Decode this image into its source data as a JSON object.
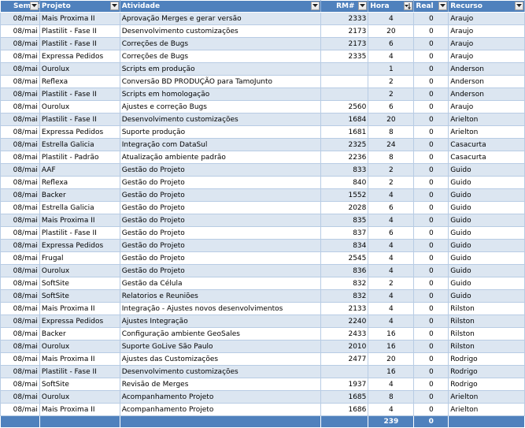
{
  "headers": {
    "semana": "Seman",
    "projeto": "Projeto",
    "atividade": "Atividade",
    "rm": "RM#",
    "hora": "Hora",
    "real": "Real",
    "recurso": "Recurso"
  },
  "rows": [
    {
      "semana": "08/mai",
      "projeto": "Mais Proxima II",
      "atividade": "Aprovação Merges e gerar versão",
      "rm": "2333",
      "hora": "4",
      "real": "0",
      "recurso": "Araujo"
    },
    {
      "semana": "08/mai",
      "projeto": "Plastilit - Fase II",
      "atividade": "Desenvolvimento customizações",
      "rm": "2173",
      "hora": "20",
      "real": "0",
      "recurso": "Araujo"
    },
    {
      "semana": "08/mai",
      "projeto": "Plastilit - Fase II",
      "atividade": "Correções de Bugs",
      "rm": "2173",
      "hora": "6",
      "real": "0",
      "recurso": "Araujo"
    },
    {
      "semana": "08/mai",
      "projeto": "Expressa Pedidos",
      "atividade": "Correções de Bugs",
      "rm": "2335",
      "hora": "4",
      "real": "0",
      "recurso": "Araujo"
    },
    {
      "semana": "08/mai",
      "projeto": "Ourolux",
      "atividade": "Scripts em produção",
      "rm": "",
      "hora": "1",
      "real": "0",
      "recurso": "Anderson"
    },
    {
      "semana": "08/mai",
      "projeto": "Reflexa",
      "atividade": "Conversão BD PRODUÇÃO para TamoJunto",
      "rm": "",
      "hora": "2",
      "real": "0",
      "recurso": "Anderson"
    },
    {
      "semana": "08/mai",
      "projeto": "Plastilit - Fase II",
      "atividade": "Scripts em homologação",
      "rm": "",
      "hora": "2",
      "real": "0",
      "recurso": "Anderson"
    },
    {
      "semana": "08/mai",
      "projeto": "Ourolux",
      "atividade": "Ajustes e correção Bugs",
      "rm": "2560",
      "hora": "6",
      "real": "0",
      "recurso": "Araujo"
    },
    {
      "semana": "08/mai",
      "projeto": "Plastilit - Fase II",
      "atividade": "Desenvolvimento customizações",
      "rm": "1684",
      "hora": "20",
      "real": "0",
      "recurso": "Arielton"
    },
    {
      "semana": "08/mai",
      "projeto": "Expressa Pedidos",
      "atividade": "Suporte produção",
      "rm": "1681",
      "hora": "8",
      "real": "0",
      "recurso": "Arielton"
    },
    {
      "semana": "08/mai",
      "projeto": "Estrella Galicia",
      "atividade": "Integração com DataSul",
      "rm": "2325",
      "hora": "24",
      "real": "0",
      "recurso": "Casacurta"
    },
    {
      "semana": "08/mai",
      "projeto": "Plastilit - Padrão",
      "atividade": "Atualização ambiente padrão",
      "rm": "2236",
      "hora": "8",
      "real": "0",
      "recurso": "Casacurta"
    },
    {
      "semana": "08/mai",
      "projeto": "AAF",
      "atividade": "Gestão do Projeto",
      "rm": "833",
      "hora": "2",
      "real": "0",
      "recurso": "Guido"
    },
    {
      "semana": "08/mai",
      "projeto": "Reflexa",
      "atividade": "Gestão do Projeto",
      "rm": "840",
      "hora": "2",
      "real": "0",
      "recurso": "Guido"
    },
    {
      "semana": "08/mai",
      "projeto": "Backer",
      "atividade": "Gestão do Projeto",
      "rm": "1552",
      "hora": "4",
      "real": "0",
      "recurso": "Guido"
    },
    {
      "semana": "08/mai",
      "projeto": "Estrella Galicia",
      "atividade": "Gestão do Projeto",
      "rm": "2028",
      "hora": "6",
      "real": "0",
      "recurso": "Guido"
    },
    {
      "semana": "08/mai",
      "projeto": "Mais Proxima II",
      "atividade": "Gestão do Projeto",
      "rm": "835",
      "hora": "4",
      "real": "0",
      "recurso": "Guido"
    },
    {
      "semana": "08/mai",
      "projeto": "Plastilit - Fase II",
      "atividade": "Gestão do Projeto",
      "rm": "837",
      "hora": "6",
      "real": "0",
      "recurso": "Guido"
    },
    {
      "semana": "08/mai",
      "projeto": "Expressa Pedidos",
      "atividade": "Gestão do Projeto",
      "rm": "834",
      "hora": "4",
      "real": "0",
      "recurso": "Guido"
    },
    {
      "semana": "08/mai",
      "projeto": "Frugal",
      "atividade": "Gestão do Projeto",
      "rm": "2545",
      "hora": "4",
      "real": "0",
      "recurso": "Guido"
    },
    {
      "semana": "08/mai",
      "projeto": "Ourolux",
      "atividade": "Gestão do Projeto",
      "rm": "836",
      "hora": "4",
      "real": "0",
      "recurso": "Guido"
    },
    {
      "semana": "08/mai",
      "projeto": "SoftSite",
      "atividade": "Gestão da Célula",
      "rm": "832",
      "hora": "2",
      "real": "0",
      "recurso": "Guido"
    },
    {
      "semana": "08/mai",
      "projeto": "SoftSite",
      "atividade": "Relatorios e Reuniões",
      "rm": "832",
      "hora": "4",
      "real": "0",
      "recurso": "Guido"
    },
    {
      "semana": "08/mai",
      "projeto": "Mais Proxima II",
      "atividade": "Integração - Ajustes novos desenvolvimentos",
      "rm": "2133",
      "hora": "4",
      "real": "0",
      "recurso": "Rilston"
    },
    {
      "semana": "08/mai",
      "projeto": "Expressa Pedidos",
      "atividade": "Ajustes Integração",
      "rm": "2240",
      "hora": "4",
      "real": "0",
      "recurso": "Rilston"
    },
    {
      "semana": "08/mai",
      "projeto": "Backer",
      "atividade": "Configuração ambiente GeoSales",
      "rm": "2433",
      "hora": "16",
      "real": "0",
      "recurso": "Rilston"
    },
    {
      "semana": "08/mai",
      "projeto": "Ourolux",
      "atividade": "Suporte GoLive São Paulo",
      "rm": "2010",
      "hora": "16",
      "real": "0",
      "recurso": "Rilston"
    },
    {
      "semana": "08/mai",
      "projeto": "Mais Proxima II",
      "atividade": "Ajustes das Customizações",
      "rm": "2477",
      "hora": "20",
      "real": "0",
      "recurso": "Rodrigo"
    },
    {
      "semana": "08/mai",
      "projeto": "Plastilit - Fase II",
      "atividade": "Desenvolvimento customizações",
      "rm": "",
      "hora": "16",
      "real": "0",
      "recurso": "Rodrigo"
    },
    {
      "semana": "08/mai",
      "projeto": "SoftSite",
      "atividade": "Revisão de Merges",
      "rm": "1937",
      "hora": "4",
      "real": "0",
      "recurso": "Rodrigo"
    },
    {
      "semana": "08/mai",
      "projeto": "Ourolux",
      "atividade": "Acompanhamento Projeto",
      "rm": "1685",
      "hora": "8",
      "real": "0",
      "recurso": "Arielton"
    },
    {
      "semana": "08/mai",
      "projeto": "Mais Proxima II",
      "atividade": "Acompanhamento Projeto",
      "rm": "1686",
      "hora": "4",
      "real": "0",
      "recurso": "Arielton"
    }
  ],
  "totals": {
    "hora": "239",
    "real": "0"
  }
}
